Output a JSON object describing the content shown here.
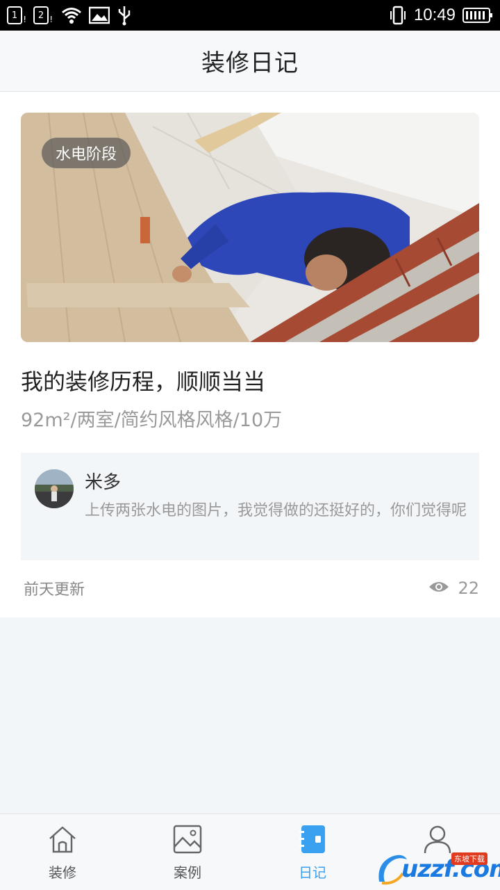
{
  "status_bar": {
    "sim1": "1",
    "sim2": "2",
    "time": "10:49",
    "icons": [
      "sim-1-icon",
      "sim-2-icon",
      "wifi-icon",
      "image-notification-icon",
      "usb-icon",
      "vibrate-icon",
      "battery-icon"
    ]
  },
  "header": {
    "title": "装修日记"
  },
  "diary": {
    "stage_badge": "水电阶段",
    "title": "我的装修历程，顺顺当当",
    "meta": "92m²/两室/简约风格风格/10万",
    "comment": {
      "author": "米多",
      "text": "上传两张水电的图片，我觉得做的还挺好的，你们觉得呢"
    },
    "updated": "前天更新",
    "views": "22"
  },
  "tabs": [
    {
      "label": "装修",
      "icon": "home-icon",
      "active": false
    },
    {
      "label": "案例",
      "icon": "image-icon",
      "active": false
    },
    {
      "label": "日记",
      "icon": "notebook-icon",
      "active": true
    },
    {
      "label": "",
      "icon": "user-icon",
      "active": false
    }
  ],
  "watermark": {
    "brand": "uzzf.com",
    "badge": "东坡下载"
  },
  "colors": {
    "accent": "#3aa0f0",
    "background": "#f3f6f9",
    "card": "#ffffff"
  }
}
